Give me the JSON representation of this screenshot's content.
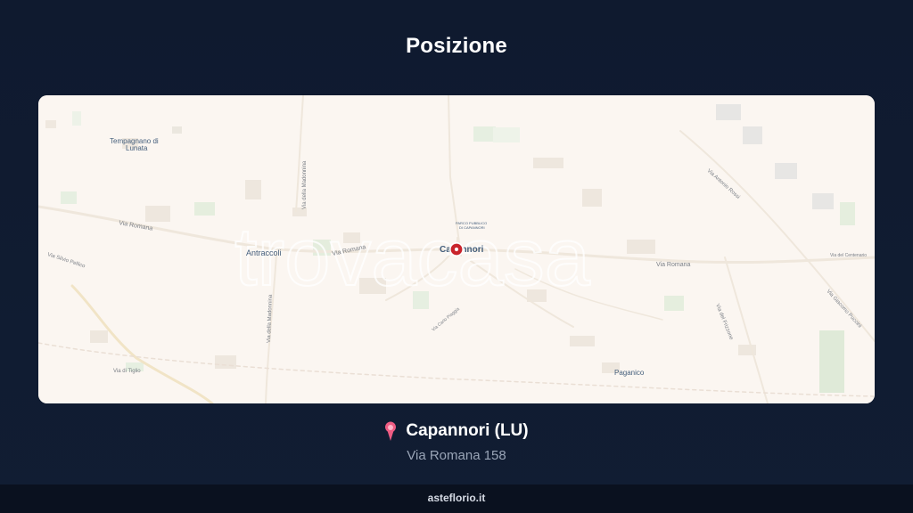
{
  "header": {
    "title": "Posizione"
  },
  "map": {
    "watermark_text": "trovacasa",
    "place_labels": [
      "Tempagnano di Lunata",
      "Antraccoli",
      "Capannori",
      "Paganico",
      "PARCO PUBBLICO DI CAPANNORI"
    ],
    "road_labels": [
      "Via Romana",
      "Via della Madonnina",
      "Via Silvio Pellico",
      "Via di Tiglio",
      "Via Antonio Rossi",
      "Via Giacomo Puccini",
      "Via del Frizzone",
      "Via del Centenario",
      "Via Carlo Piaggia"
    ],
    "colors": {
      "background": "#fbf6f1",
      "marker": "#c9242b"
    }
  },
  "location": {
    "name": "Capannori (LU)",
    "address": "Via Romana 158",
    "pin_icon": "map-pin-icon"
  },
  "footer": {
    "site": "asteflorio.it"
  }
}
